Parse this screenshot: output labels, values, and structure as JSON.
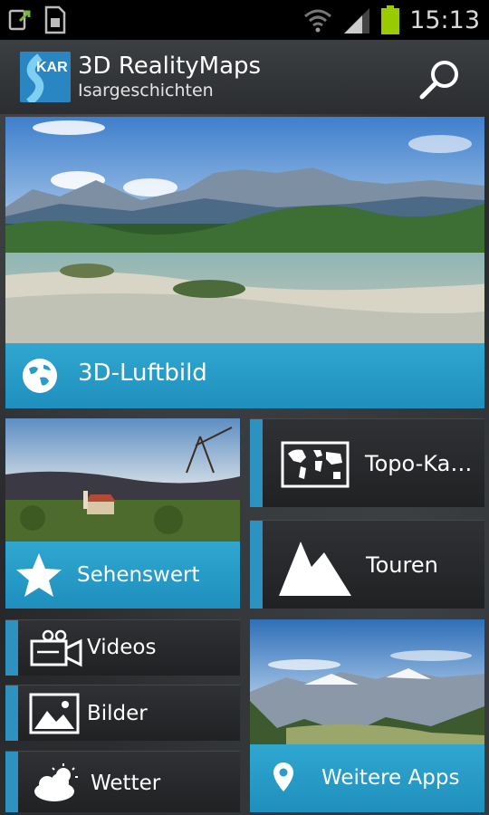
{
  "status_bar": {
    "time": "15:13",
    "icons": [
      "usb-debug-icon",
      "sim-icon",
      "wifi-icon",
      "signal-icon",
      "battery-icon"
    ]
  },
  "header": {
    "logo_text": "KAR",
    "title": "3D RealityMaps",
    "subtitle": "Isargeschichten",
    "search_icon": "search-icon"
  },
  "tiles": {
    "luftbild": {
      "label": "3D-Luftbild",
      "icon": "globe-icon"
    },
    "topo": {
      "label": "Topo-Ka…",
      "icon": "world-map-icon"
    },
    "sehenswert": {
      "label": "Sehenswert",
      "icon": "star-icon"
    },
    "touren": {
      "label": "Touren",
      "icon": "mountain-icon"
    },
    "videos": {
      "label": "Videos",
      "icon": "video-camera-icon"
    },
    "bilder": {
      "label": "Bilder",
      "icon": "picture-icon"
    },
    "wetter": {
      "label": "Wetter",
      "icon": "weather-icon"
    },
    "weitere": {
      "label": "Weitere Apps",
      "icon": "location-pin-icon"
    }
  },
  "colors": {
    "accent": "#2d92bf",
    "status_bar": "#000000",
    "battery": "#99cc00"
  }
}
